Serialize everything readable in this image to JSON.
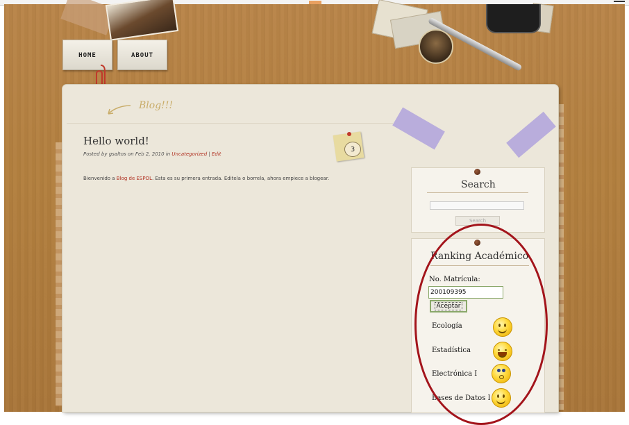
{
  "nav": {
    "home": "HOME",
    "about": "ABOUT"
  },
  "blog": {
    "logo": "Blog!!!"
  },
  "post": {
    "title": "Hello world!",
    "meta_prefix": "Posted by ",
    "author": "gsaltos",
    "meta_on": " on Feb 2, 2010 in ",
    "category": "Uncategorized",
    "meta_sep": " | ",
    "edit": "Edit",
    "body_prefix": "Bienvenido a ",
    "body_link": "Blog de ESPOL",
    "body_suffix": ". Esta es su primera entrada. Editela o borrela, ahora empiece a blogear.",
    "comments": "3"
  },
  "sidebar": {
    "search": {
      "title": "Search",
      "button": "Search",
      "value": ""
    },
    "ranking": {
      "title": "Ranking Académico",
      "matricula_label": "No. Matrícula:",
      "matricula_value": "200109395",
      "accept_button": "Aceptar",
      "courses": [
        {
          "name": "Ecología",
          "icon": "smiley-happy-icon"
        },
        {
          "name": "Estadística",
          "icon": "smiley-laughing-icon"
        },
        {
          "name": "Electrónica I",
          "icon": "smiley-surprised-icon"
        },
        {
          "name": "Bases de Datos I",
          "icon": "smiley-happy-icon"
        }
      ]
    }
  },
  "colors": {
    "accent_link": "#b03020",
    "highlight_oval": "#a3141b",
    "wood": "#b3803f",
    "paper": "#ece7da"
  }
}
